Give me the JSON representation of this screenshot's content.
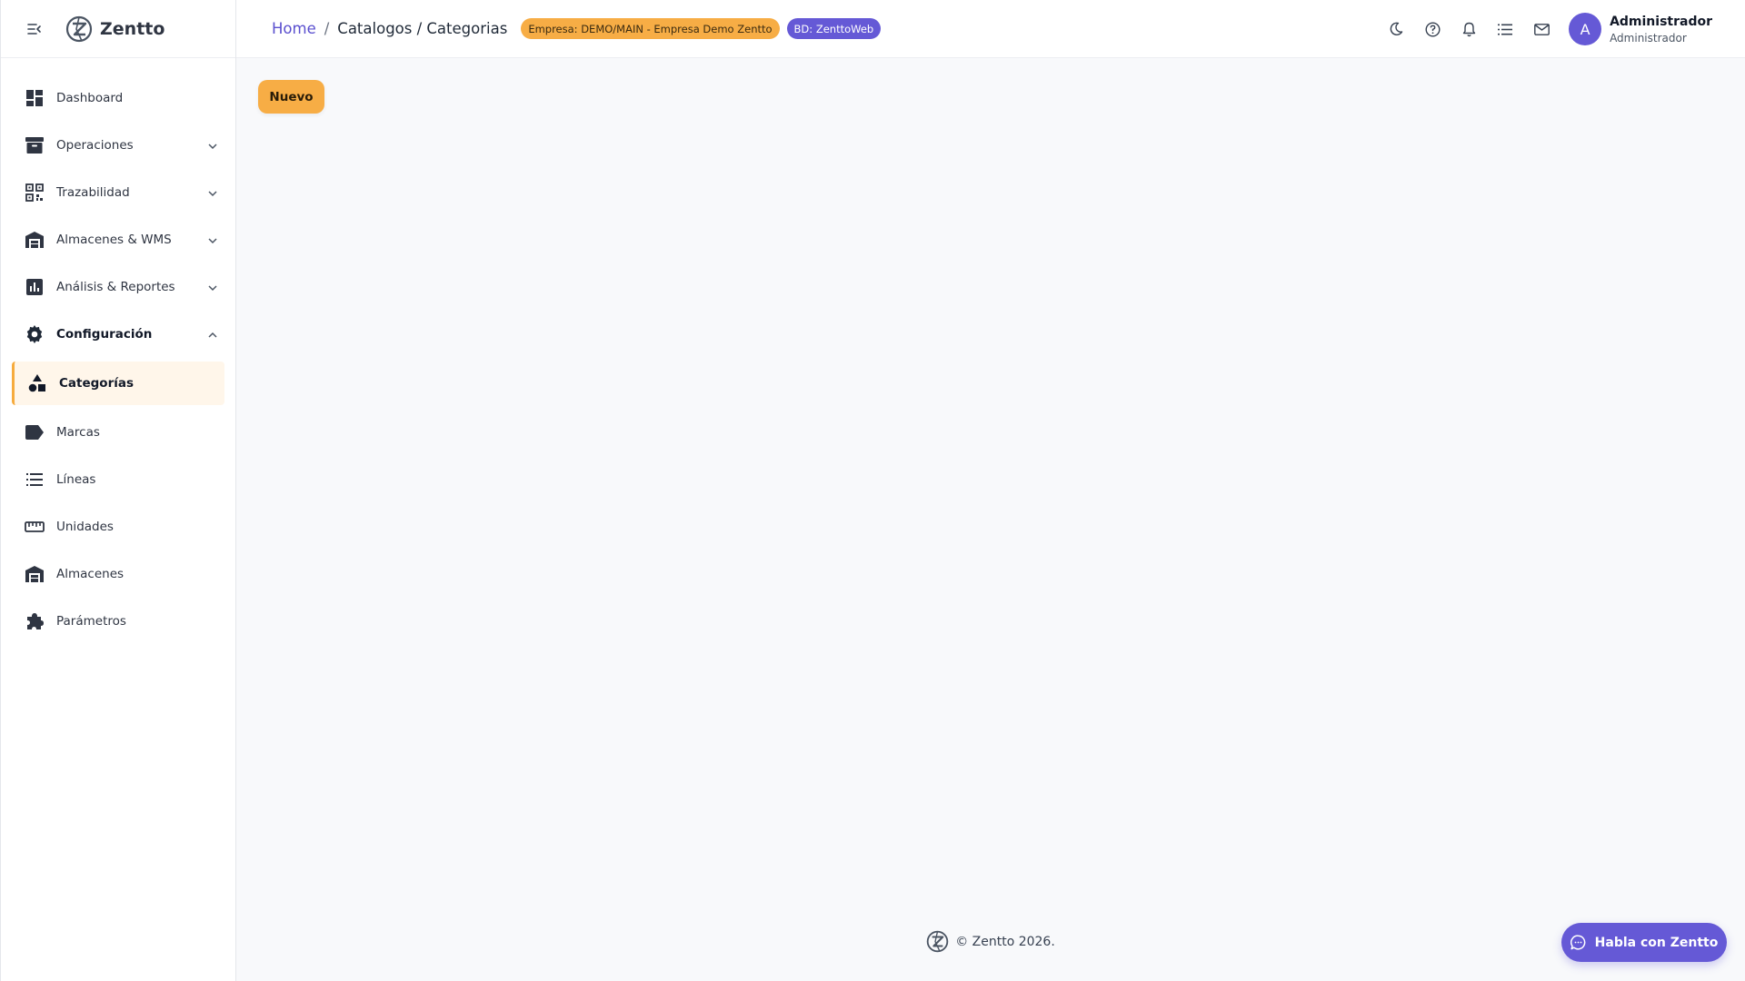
{
  "brand": {
    "name": "Zentto",
    "menu_icon": "menu-collapse-icon",
    "logo_icon": "zentto-logo-icon"
  },
  "sidebar": {
    "items": [
      {
        "label": "Dashboard",
        "icon": "dashboard-icon",
        "expandable": false
      },
      {
        "label": "Operaciones",
        "icon": "archive-box-icon",
        "expandable": true
      },
      {
        "label": "Trazabilidad",
        "icon": "qr-code-icon",
        "expandable": true
      },
      {
        "label": "Almacenes & WMS",
        "icon": "warehouse-icon",
        "expandable": true
      },
      {
        "label": "Análisis & Reportes",
        "icon": "bar-chart-icon",
        "expandable": true
      },
      {
        "label": "Configuración",
        "icon": "gear-icon",
        "expandable": true,
        "expanded": true
      },
      {
        "label": "Categorías",
        "icon": "category-shapes-icon",
        "active": true
      },
      {
        "label": "Marcas",
        "icon": "label-tag-icon"
      },
      {
        "label": "Líneas",
        "icon": "list-lines-icon"
      },
      {
        "label": "Unidades",
        "icon": "ruler-icon"
      },
      {
        "label": "Almacenes",
        "icon": "warehouse-icon"
      },
      {
        "label": "Parámetros",
        "icon": "puzzle-icon"
      }
    ]
  },
  "header": {
    "breadcrumb": {
      "home": "Home",
      "separator": "/",
      "current": "Catalogos / Categorias"
    },
    "empresa_badge": "Empresa: DEMO/MAIN - Empresa Demo Zentto",
    "bd_badge": "BD: ZenttoWeb",
    "icons": [
      "dark-mode-icon",
      "help-icon",
      "notifications-bell-icon",
      "tasks-list-icon",
      "mail-icon"
    ],
    "user": {
      "initial": "A",
      "name": "Administrador",
      "role": "Administrador"
    }
  },
  "main": {
    "new_button": "Nuevo"
  },
  "footer": {
    "text": "© Zentto 2026."
  },
  "chat": {
    "label": "Habla con Zentto",
    "icon": "chat-bubble-icon"
  },
  "colors": {
    "accent_orange": "#f7ad45",
    "accent_purple": "#6559d6",
    "active_bg": "#fff6ea",
    "link": "#5a4fcf"
  }
}
